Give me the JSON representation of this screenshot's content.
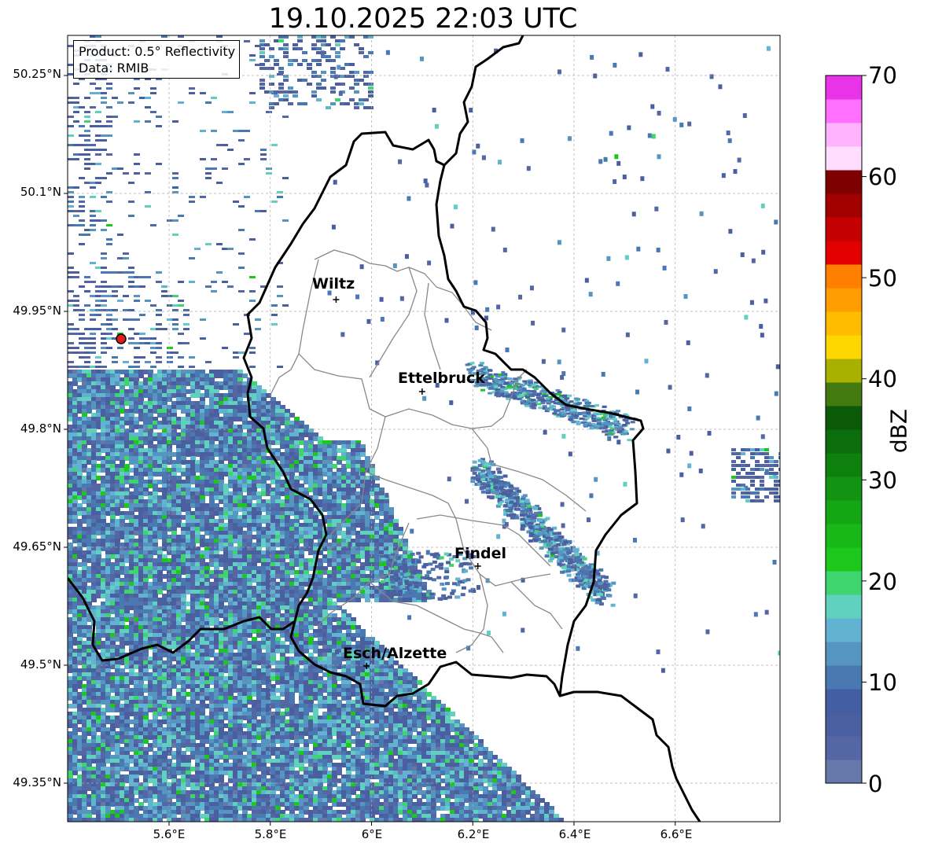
{
  "title": "19.10.2025 22:03 UTC",
  "info_box": {
    "product": "Product: 0.5° Reflectivity",
    "data_source": "Data: RMIB"
  },
  "axes": {
    "lat_ticks": [
      "50.25°N",
      "50.1°N",
      "49.95°N",
      "49.8°N",
      "49.65°N",
      "49.5°N",
      "49.35°N"
    ],
    "lon_ticks": [
      "5.6°E",
      "5.8°E",
      "6°E",
      "6.2°E",
      "6.4°E",
      "6.6°E"
    ],
    "lat_values": [
      50.25,
      50.1,
      49.95,
      49.8,
      49.65,
      49.5,
      49.35
    ],
    "lon_values": [
      5.6,
      5.8,
      6.0,
      6.2,
      6.4,
      6.6
    ],
    "grid": true
  },
  "cities": [
    {
      "name": "Wiltz",
      "lon": 5.93,
      "lat": 49.965
    },
    {
      "name": "Ettelbruck",
      "lon": 6.1,
      "lat": 49.848
    },
    {
      "name": "Findel",
      "lon": 6.21,
      "lat": 49.626
    },
    {
      "name": "Esch/Alzette",
      "lon": 5.99,
      "lat": 49.499
    }
  ],
  "radar_site_color": "#e41a1c",
  "colorbar": {
    "label": "dBZ",
    "ticks": [
      "0",
      "10",
      "20",
      "30",
      "40",
      "50",
      "60",
      "70"
    ],
    "range": [
      0,
      70
    ],
    "colors": [
      "#6677aa",
      "#5566a5",
      "#4a5fa0",
      "#445ea3",
      "#4a78b0",
      "#5595c0",
      "#62b3d2",
      "#60d0bf",
      "#3ed46e",
      "#1cc81c",
      "#18b818",
      "#14a614",
      "#129412",
      "#0e800e",
      "#0b6d0b",
      "#0a5a0a",
      "#437a10",
      "#a8b000",
      "#ffd700",
      "#ffbb00",
      "#ff9d00",
      "#ff7f00",
      "#e30000",
      "#c40000",
      "#a20000",
      "#7e0000",
      "#ffddff",
      "#ffb3ff",
      "#ff70ff",
      "#e833e8"
    ]
  }
}
